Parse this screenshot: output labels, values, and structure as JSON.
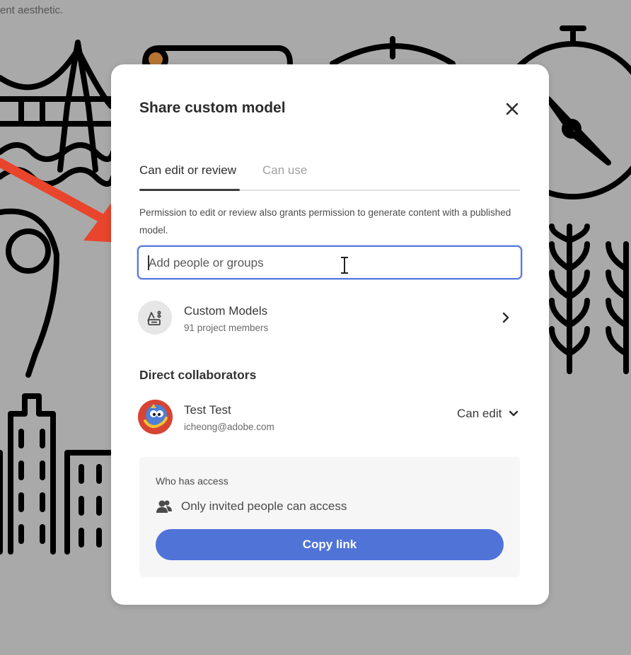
{
  "background": {
    "caption": "ent aesthetic."
  },
  "modal": {
    "title": "Share custom model",
    "close_icon": "close-icon",
    "tabs": [
      {
        "label": "Can edit or review",
        "active": true
      },
      {
        "label": "Can use",
        "active": false
      }
    ],
    "helper_text": "Permission to edit or review also grants permission to generate content with a published model.",
    "search": {
      "value": "",
      "placeholder": "Add people or groups"
    },
    "group": {
      "name": "Custom Models",
      "members": "91 project members",
      "icon": "group-icon"
    },
    "collaborators": {
      "title": "Direct collaborators",
      "items": [
        {
          "name": "Test Test",
          "email": "icheong@adobe.com",
          "permission": "Can edit"
        }
      ]
    },
    "access": {
      "label": "Who has access",
      "status": "Only invited people can access",
      "icon": "people-icon",
      "copy_label": "Copy link"
    }
  },
  "colors": {
    "accent": "#5073d8",
    "focus_ring": "#5779de",
    "annotation_arrow": "#e8452c",
    "backdrop": "#a9a9a9"
  }
}
